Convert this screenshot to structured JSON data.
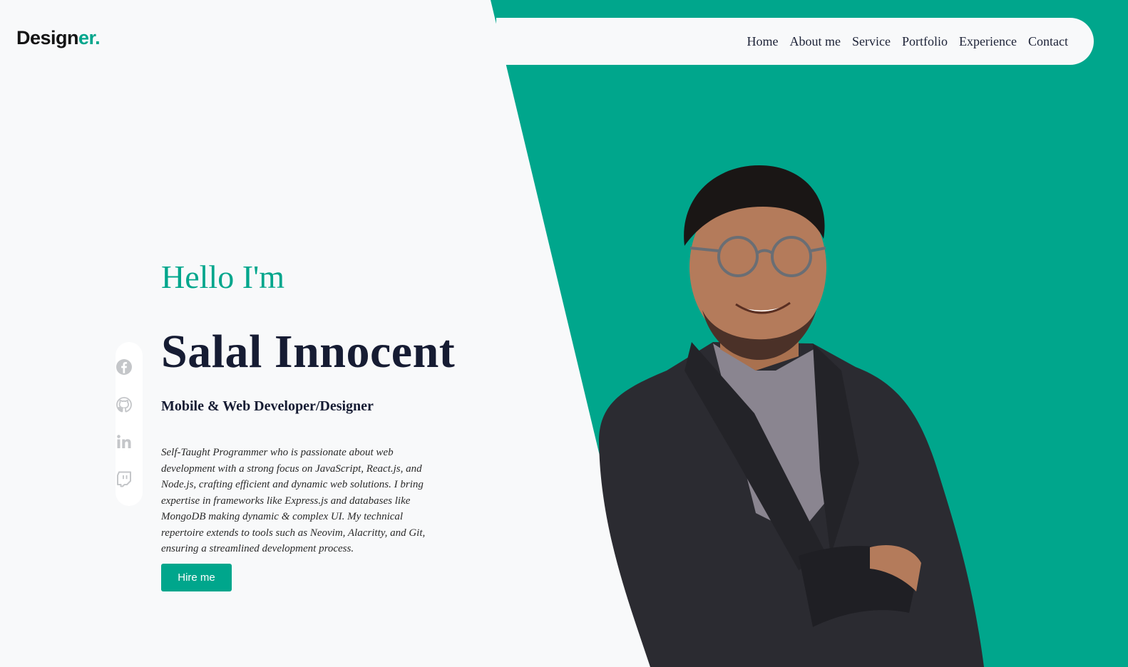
{
  "brand": {
    "logo_main": "Design",
    "logo_accent": "er."
  },
  "nav": {
    "items": [
      "Home",
      "About me",
      "Service",
      "Portfolio",
      "Experience",
      "Contact"
    ]
  },
  "social": {
    "icons": [
      "facebook-icon",
      "github-icon",
      "linkedin-icon",
      "twitch-icon"
    ]
  },
  "hero": {
    "greeting": "Hello I'm",
    "name": "Salal Innocent",
    "role": "Mobile & Web Developer/Designer",
    "bio": "Self-Taught Programmer who is passionate about web development with a strong focus on JavaScript, React.js, and Node.js, crafting efficient and dynamic web solutions. I bring expertise in frameworks like Express.js and databases like MongoDB making dynamic & complex UI. My technical repertoire extends to tools such as Neovim, Alacritty, and Git, ensuring a streamlined development process.",
    "cta_label": "Hire me"
  },
  "colors": {
    "accent": "#00a68c",
    "background": "#f8f9fa",
    "text_dark": "#161c33"
  }
}
